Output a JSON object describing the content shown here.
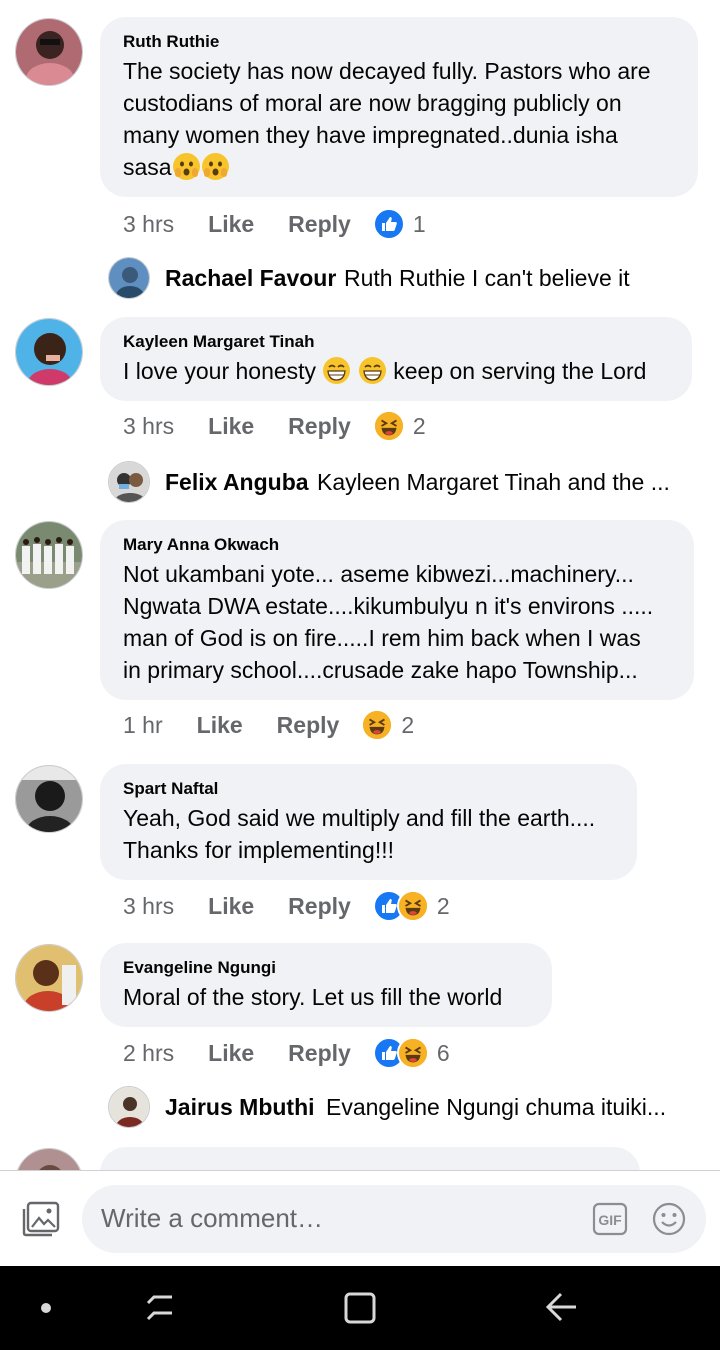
{
  "comments": [
    {
      "author": "Ruth Ruthie",
      "lines": [
        "The society has now decayed fully. Pastors who are",
        "custodians of moral are now bragging publicly on",
        "many women they have impregnated..dunia isha",
        "sasa"
      ],
      "time": "3 hrs",
      "like": "Like",
      "reply": "Reply",
      "reaction_count": "1"
    },
    {
      "author": "Kayleen Margaret Tinah",
      "line_a": "I love your honesty",
      "line_b": "keep on serving the Lord",
      "time": "3 hrs",
      "like": "Like",
      "reply": "Reply",
      "reaction_count": "2"
    },
    {
      "author": "Mary Anna Okwach",
      "lines": [
        "Not ukambani yote... aseme kibwezi...machinery...",
        "Ngwata DWA estate....kikumbulyu n it's environs .....",
        "man of God is on fire.....I rem him back when I was",
        "in primary school....crusade zake hapo Township..."
      ],
      "time": "1 hr",
      "like": "Like",
      "reply": "Reply",
      "reaction_count": "2"
    },
    {
      "author": "Spart Naftal",
      "lines": [
        "Yeah, God said we multiply and fill the earth....",
        "Thanks for implementing!!!"
      ],
      "time": "3 hrs",
      "like": "Like",
      "reply": "Reply",
      "reaction_count": "2"
    },
    {
      "author": "Evangeline Ngungi",
      "lines": [
        "Moral of the story. Let us fill the world"
      ],
      "time": "2 hrs",
      "like": "Like",
      "reply": "Reply",
      "reaction_count": "6"
    }
  ],
  "replies": [
    {
      "name": "Rachael Favour",
      "text": "Ruth Ruthie I can't believe it"
    },
    {
      "name": "Felix Anguba",
      "text": "Kayleen Margaret Tinah and the ..."
    },
    {
      "name": "Jairus Mbuthi",
      "text": "Evangeline Ngungi  chuma ituiki..."
    }
  ],
  "composer": {
    "placeholder": "Write a comment…"
  },
  "colors": {
    "bubble": "#f0f2f5",
    "like_blue": "#1877f2",
    "haha_yellow": "#f7b125",
    "meta_gray": "#65676b"
  },
  "icons": {
    "composer_left": "photo-icon",
    "gif": "gif-icon",
    "emoji": "smiley-icon",
    "nav": [
      "dot-icon",
      "recent-apps-icon",
      "home-icon",
      "back-icon"
    ]
  }
}
